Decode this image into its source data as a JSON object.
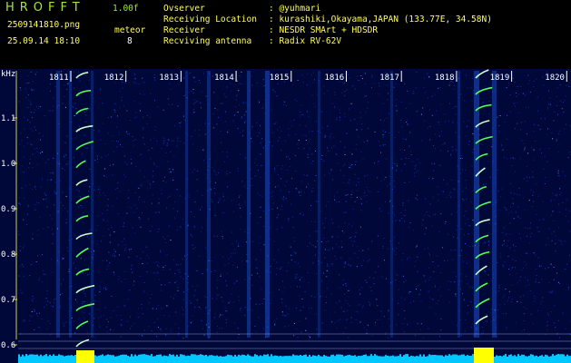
{
  "app": {
    "title": "HROFFT",
    "version": "1.00f"
  },
  "file": {
    "name": "2509141810.png",
    "datetime": "25.09.14 18:10"
  },
  "mode": {
    "label": "meteor",
    "count": "8"
  },
  "info": [
    {
      "label": "Ovserver",
      "value": ": @yuhmari"
    },
    {
      "label": "Receiving Location",
      "value": ": kurashiki,Okayama,JAPAN (133.77E, 34.58N)"
    },
    {
      "label": "Receiver",
      "value": ": NESDR SMArt + HDSDR"
    },
    {
      "label": "Recviving antenna",
      "value": ": Radix RV-62V"
    }
  ],
  "axis": {
    "unit": "kHz",
    "y_ticks": [
      "1.1",
      "1.0",
      "0.9",
      "0.8",
      "0.7",
      "0.6"
    ]
  },
  "time_labels": [
    "1811",
    "1812",
    "1813",
    "1814",
    "1815",
    "1816",
    "1817",
    "1818",
    "1819",
    "1820"
  ],
  "colors": {
    "background": "#00083a",
    "header_text": "#ffff55",
    "app_title": "#9eea3e",
    "signal": "#55ff55",
    "level_bar": "#ffff00",
    "noise_floor": "#00c8ff"
  }
}
